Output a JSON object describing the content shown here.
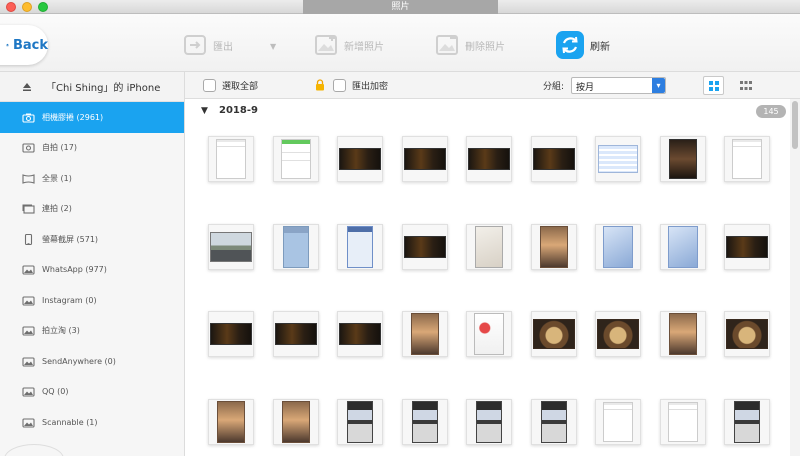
{
  "window": {
    "title": "照片"
  },
  "toolbar": {
    "back_label": "Back",
    "export_label": "匯出",
    "add_label": "新增照片",
    "delete_label": "刪除照片",
    "refresh_label": "刷新"
  },
  "sidebar": {
    "device_label": "「Chi Shing」的 iPhone",
    "items": [
      {
        "label": "相機膠捲 (2961)",
        "icon": "camera-icon"
      },
      {
        "label": "自拍 (17)",
        "icon": "selfie-icon"
      },
      {
        "label": "全景 (1)",
        "icon": "panorama-icon"
      },
      {
        "label": "連拍 (2)",
        "icon": "burst-icon"
      },
      {
        "label": "螢幕截屏 (571)",
        "icon": "phone-icon"
      },
      {
        "label": "WhatsApp (977)",
        "icon": "album-icon"
      },
      {
        "label": "Instagram (0)",
        "icon": "album-icon"
      },
      {
        "label": "拍立淘 (3)",
        "icon": "album-icon"
      },
      {
        "label": "SendAnywhere (0)",
        "icon": "album-icon"
      },
      {
        "label": "QQ (0)",
        "icon": "album-icon"
      },
      {
        "label": "Scannable (1)",
        "icon": "album-icon"
      }
    ]
  },
  "options": {
    "select_all_label": "選取全部",
    "encrypt_export_label": "匯出加密",
    "group_label": "分組:",
    "group_value": "按月"
  },
  "group": {
    "title": "2018-9",
    "count": "145"
  },
  "photos": [
    "document",
    "document-green",
    "dark-video",
    "dark-video",
    "dark-video",
    "dark-video",
    "spreadsheet",
    "dark-photo",
    "document",
    "street-photo",
    "chat-green",
    "chat-blue",
    "dark-video",
    "paper",
    "child-photo",
    "blue-paper",
    "blue-paper",
    "dark-video",
    "dark-video",
    "dark-video",
    "dark-video",
    "child-photo",
    "app-screen",
    "food-photo",
    "food-photo",
    "child-photo",
    "food-photo",
    "child-photo",
    "child-photo",
    "dark-screenshot",
    "dark-screenshot",
    "dark-screenshot",
    "dark-screenshot",
    "document",
    "document",
    "dark-screenshot"
  ],
  "colors": {
    "accent": "#1aa3f0",
    "brand_blue": "#1e77c4",
    "select_arrow": "#2d7ee0"
  }
}
